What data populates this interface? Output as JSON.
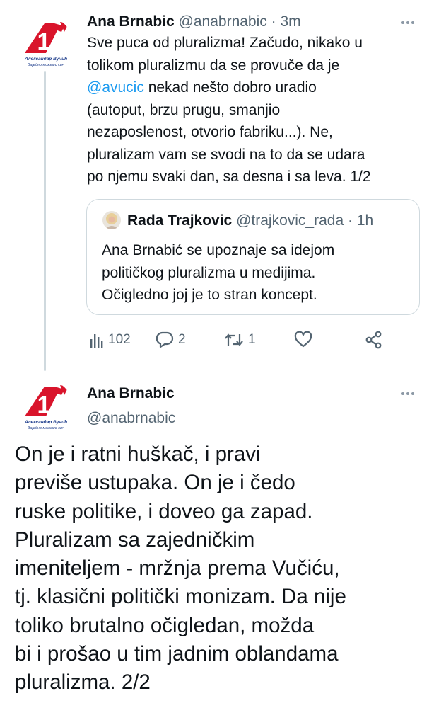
{
  "tweet1": {
    "author_name": "Ana Brnabic",
    "author_handle": "@anabrnabic",
    "separator": "·",
    "time": "3m",
    "avatar_caption_line1": "Александар Вучић",
    "avatar_caption_line2": "Заједно можемо све",
    "avatar_number": "1",
    "text_lines": [
      "Sve puca od pluralizma! Začudo, nikako u",
      "tolikom pluralizmu da se provuče da je",
      "nekad nešto dobro uradio",
      "(autoput, brzu prugu, smanjio",
      "nezaposlenost, otvorio fabriku...). Ne,",
      "pluralizam vam se svodi na to da se udara",
      "po njemu svaki dan, sa desna i sa leva. 1/2"
    ],
    "mention": "@avucic",
    "quote": {
      "author_name": "Rada Trajkovic",
      "author_handle": "@trajkovic_rada",
      "separator": "·",
      "time": "1h",
      "text_lines": [
        "Ana Brnabić se upoznaje sa idejom",
        "političkog pluralizma u medijima.",
        "Očigledno joj je to stran koncept."
      ]
    },
    "actions": {
      "views": "102",
      "replies": "2",
      "retweets": "1",
      "likes": "",
      "share": ""
    }
  },
  "tweet2": {
    "author_name": "Ana Brnabic",
    "author_handle": "@anabrnabic",
    "avatar_caption_line1": "Александар Вучић",
    "avatar_caption_line2": "Заједно можемо све",
    "avatar_number": "1",
    "text_lines": [
      "On je i ratni huškač, i pravi",
      "previše ustupaka. On je i čedo",
      "ruske politike, i doveo ga zapad.",
      "Pluralizam sa zajedničkim",
      "imeniteljem - mržnja prema Vučiću,",
      "tj. klasični politički monizam. Da nije",
      "toliko brutalno očigledan, možda",
      "bi i prošao u tim jadnim oblandama",
      "pluralizma. 2/2"
    ]
  },
  "colors": {
    "accent_blue": "#1d9bf0",
    "logo_red": "#d9142b",
    "muted": "#536471",
    "border": "#cfd9de"
  },
  "icons": [
    "views-icon",
    "reply-icon",
    "retweet-icon",
    "like-icon",
    "share-icon",
    "more-icon"
  ]
}
